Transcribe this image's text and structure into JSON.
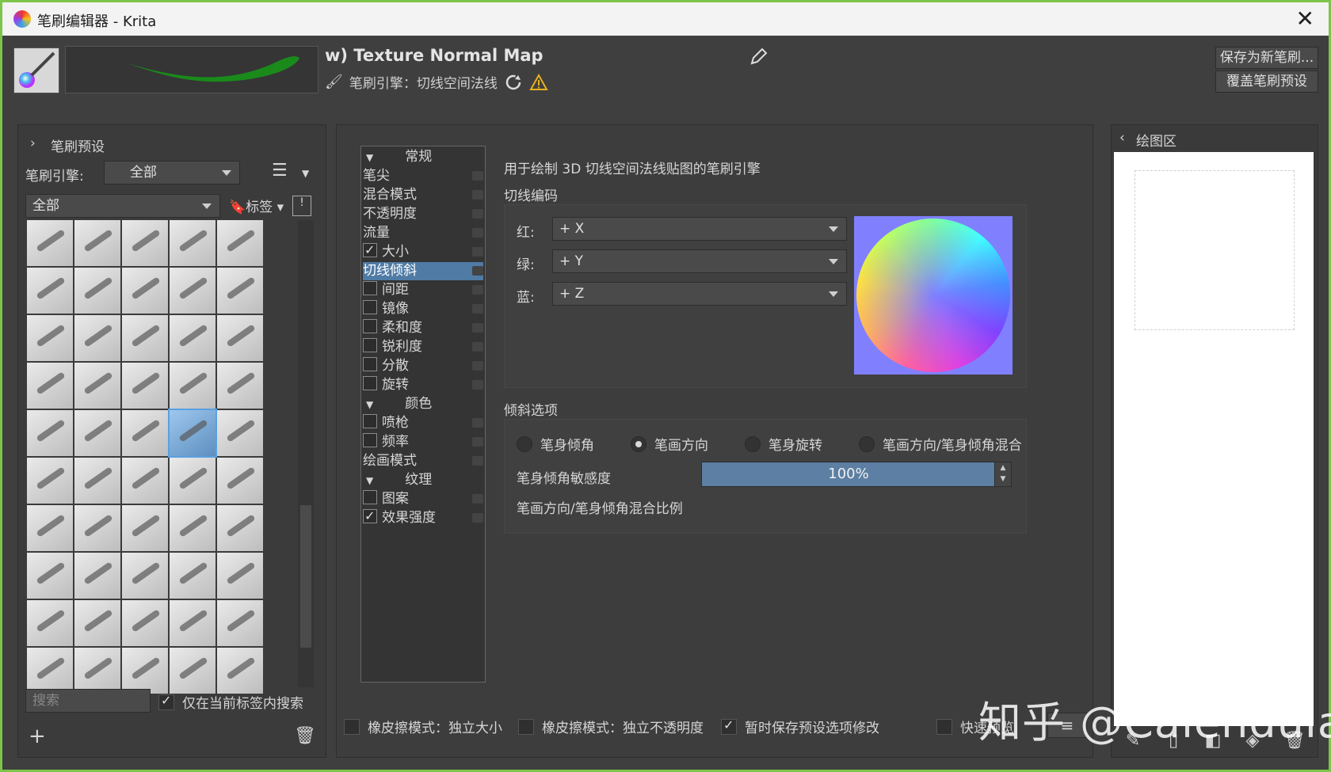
{
  "window": {
    "title": "笔刷编辑器 - Krita",
    "close_glyph": "✕"
  },
  "header": {
    "preset_name": "w) Texture Normal Map",
    "engine_label": "笔刷引擎：切线空间法线",
    "save_new_label": "保存为新笔刷...",
    "overwrite_label": "覆盖笔刷预设"
  },
  "preset_panel": {
    "title": "笔刷预设",
    "engine_label": "笔刷引擎:",
    "engine_value": "全部",
    "tag_value": "全部",
    "tag_button": "标签",
    "search_placeholder": "搜索",
    "only_in_tag_label": "仅在当前标签内搜索",
    "only_in_tag_checked": true,
    "brush_count": 50,
    "selected_index": 23
  },
  "options": [
    {
      "label": "常规",
      "type": "category"
    },
    {
      "label": "笔尖",
      "type": "plain"
    },
    {
      "label": "混合模式",
      "type": "plain"
    },
    {
      "label": "不透明度",
      "type": "plain"
    },
    {
      "label": "流量",
      "type": "plain"
    },
    {
      "label": "大小",
      "type": "check",
      "checked": true
    },
    {
      "label": "切线倾斜",
      "type": "plain",
      "selected": true
    },
    {
      "label": "间距",
      "type": "check",
      "checked": false
    },
    {
      "label": "镜像",
      "type": "check",
      "checked": false
    },
    {
      "label": "柔和度",
      "type": "check",
      "checked": false
    },
    {
      "label": "锐利度",
      "type": "check",
      "checked": false
    },
    {
      "label": "分散",
      "type": "check",
      "checked": false
    },
    {
      "label": "旋转",
      "type": "check",
      "checked": false
    },
    {
      "label": "颜色",
      "type": "category"
    },
    {
      "label": "喷枪",
      "type": "check",
      "checked": false
    },
    {
      "label": "频率",
      "type": "check",
      "checked": false
    },
    {
      "label": "绘画模式",
      "type": "plain"
    },
    {
      "label": "纹理",
      "type": "category"
    },
    {
      "label": "图案",
      "type": "check",
      "checked": false
    },
    {
      "label": "效果强度",
      "type": "check",
      "checked": true
    }
  ],
  "settings": {
    "description": "用于绘制 3D 切线空间法线贴图的笔刷引擎",
    "encoding_title": "切线编码",
    "red_label": "红:",
    "red_value": "+ X",
    "green_label": "绿:",
    "green_value": "+ Y",
    "blue_label": "蓝:",
    "blue_value": "+ Z",
    "tilt_title": "倾斜选项",
    "radios": [
      {
        "label": "笔身倾角",
        "checked": false
      },
      {
        "label": "笔画方向",
        "checked": true
      },
      {
        "label": "笔身旋转",
        "checked": false
      },
      {
        "label": "笔画方向/笔身倾角混合",
        "checked": false
      }
    ],
    "sensitivity_label": "笔身倾角敏感度",
    "sensitivity_value": "100%",
    "sensitivity_fraction": 1.0,
    "mix_ratio_label": "笔画方向/笔身倾角混合比例"
  },
  "bottom": {
    "eraser_size": "橡皮擦模式：独立大小",
    "eraser_size_checked": false,
    "eraser_opacity": "橡皮擦模式：独立不透明度",
    "eraser_opacity_checked": false,
    "temp_save": "暂时保存预设选项修改",
    "temp_save_checked": true,
    "fast_preview": "快速预览"
  },
  "scratchpad": {
    "title": "绘图区"
  },
  "watermark": "知乎 @Calendula",
  "colors": {
    "accent_selected": "#4f7ba5",
    "frame_green": "#7dc54a",
    "normal_map_bg": "#8080ff"
  }
}
